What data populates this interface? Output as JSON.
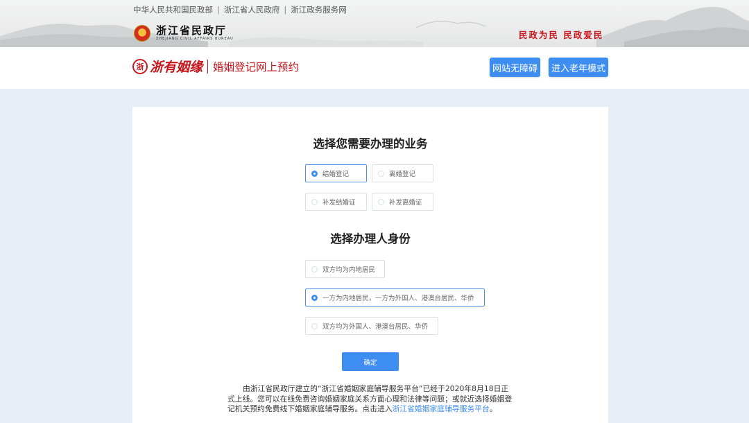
{
  "header": {
    "gov_links": [
      "中华人民共和国民政部",
      "浙江省人民政府",
      "浙江政务服务网"
    ],
    "bureau_name": "浙江省民政厅",
    "bureau_en": "ZHEJIANG CIVIL AFFAIRS BUREAU",
    "slogan": "民政为民 民政爱民"
  },
  "nav": {
    "brand_name": "浙有姻缘",
    "brand_sub": "婚姻登记网上预约",
    "accessibility_button": "网站无障碍",
    "elder_mode_button": "进入老年模式"
  },
  "business": {
    "title": "选择您需要办理的业务",
    "options": [
      {
        "label": "结婚登记",
        "selected": true
      },
      {
        "label": "离婚登记",
        "selected": false
      },
      {
        "label": "补发结婚证",
        "selected": false
      },
      {
        "label": "补发离婚证",
        "selected": false
      }
    ]
  },
  "identity": {
    "title": "选择办理人身份",
    "options": [
      {
        "label": "双方均为内地居民",
        "selected": false
      },
      {
        "label": "一方为内地居民，一方为外国人、港澳台居民、华侨",
        "selected": true
      },
      {
        "label": "双方均为外国人、港澳台居民、华侨",
        "selected": false
      }
    ]
  },
  "confirm_button": "确定",
  "notice": {
    "text": "由浙江省民政厅建立的“浙江省婚姻家庭辅导服务平台”已经于2020年8月18日正式上线。您可以在线免费咨询婚姻家庭关系方面心理和法律等问题；或就近选择婚姻登记机关预约免费线下婚姻家庭辅导服务。点击进入",
    "link": "浙江省婚姻家庭辅导服务平台",
    "end": "。"
  },
  "colors": {
    "accent": "#3e8ef2",
    "brand_red": "#c8161d",
    "page_bg": "#e8eef5"
  }
}
